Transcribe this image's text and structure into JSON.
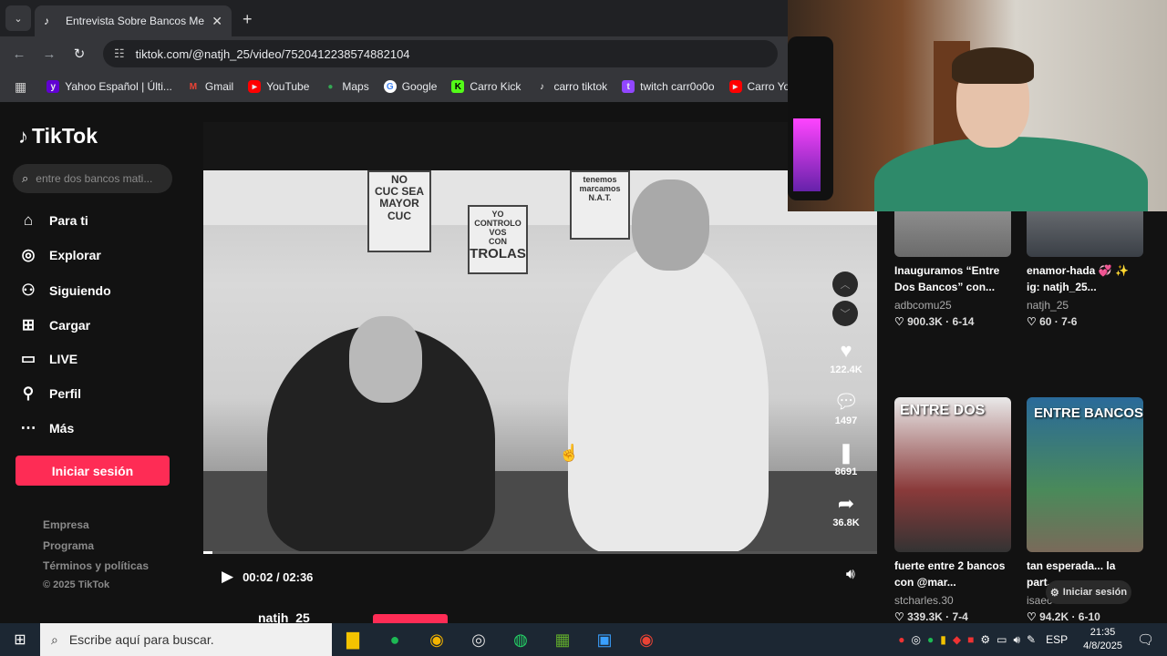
{
  "browser": {
    "tab_title": "Entrevista Sobre Bancos Mexica",
    "url": "tiktok.com/@natjh_25/video/7520412238574882104",
    "bookmarks": [
      {
        "label": "Yahoo Español | Últi...",
        "icon": "yahoo-icon",
        "color": "#6001d2"
      },
      {
        "label": "Gmail",
        "icon": "gmail-icon",
        "color": "#ea4335"
      },
      {
        "label": "YouTube",
        "icon": "youtube-icon",
        "color": "#ff0000"
      },
      {
        "label": "Maps",
        "icon": "maps-icon",
        "color": "#34a853"
      },
      {
        "label": "Google",
        "icon": "google-icon",
        "color": "#4285f4"
      },
      {
        "label": "Carro Kick",
        "icon": "kick-icon",
        "color": "#53fc18"
      },
      {
        "label": "carro tiktok",
        "icon": "tiktok-icon",
        "color": "#000000"
      },
      {
        "label": "twitch carr0o0o",
        "icon": "twitch-icon",
        "color": "#9146ff"
      },
      {
        "label": "Carro YouTub",
        "icon": "youtube-icon",
        "color": "#ff0000"
      }
    ]
  },
  "tiktok": {
    "logo": "TikTok",
    "search_placeholder": "entre dos bancos mati...",
    "nav": [
      {
        "label": "Para ti",
        "icon": "home-icon"
      },
      {
        "label": "Explorar",
        "icon": "compass-icon"
      },
      {
        "label": "Siguiendo",
        "icon": "following-icon"
      },
      {
        "label": "Cargar",
        "icon": "upload-icon"
      },
      {
        "label": "LIVE",
        "icon": "live-icon"
      },
      {
        "label": "Perfil",
        "icon": "profile-icon"
      },
      {
        "label": "Más",
        "icon": "more-icon"
      }
    ],
    "login_label": "Iniciar sesión",
    "footer": [
      "Empresa",
      "Programa",
      "Términos y políticas",
      "© 2025 TikTok"
    ],
    "video": {
      "time": "00:02 / 02:36",
      "progress": 0.013,
      "likes": "122.4K",
      "comments": "1497",
      "saves": "8691",
      "shares": "36.8K",
      "author": "natjh_25",
      "signs": [
        "NO",
        "CUC SEA",
        "MAYOR",
        "CUC",
        "YO CONTROLO",
        "VOS",
        "CON",
        "TROLAS",
        "tenemos",
        "marcamos",
        "N.A.T."
      ]
    },
    "related": [
      {
        "title": "Inauguramos “Entre Dos Bancos” con...",
        "user": "adbcomu25",
        "meta": "♡ 900.3K · 6-14",
        "tint": "#6b6b6b"
      },
      {
        "title": "enamor-hada 💞 ✨ ig: natjh_25...",
        "user": "natjh_25",
        "meta": "♡ 60 · 7-6",
        "tint": "#5a5f66"
      },
      {
        "title": "fuerte entre 2 bancos con @mar...",
        "user": "stcharles.30",
        "meta": "♡ 339.3K · 7-4",
        "tint": "#8a3a3a",
        "overlay": "ENTRE DOS"
      },
      {
        "title": "tan esperada... la part...",
        "user": "isaec",
        "meta": "♡ 94.2K · 6-10",
        "tint": "#2a6a9a",
        "overlay": "ENTRE BANCOS"
      }
    ],
    "toast_label": "Iniciar sesión"
  },
  "taskbar": {
    "search_placeholder": "Escribe aquí para buscar.",
    "lang": "ESP",
    "time": "21:35",
    "date": "4/8/2025"
  }
}
